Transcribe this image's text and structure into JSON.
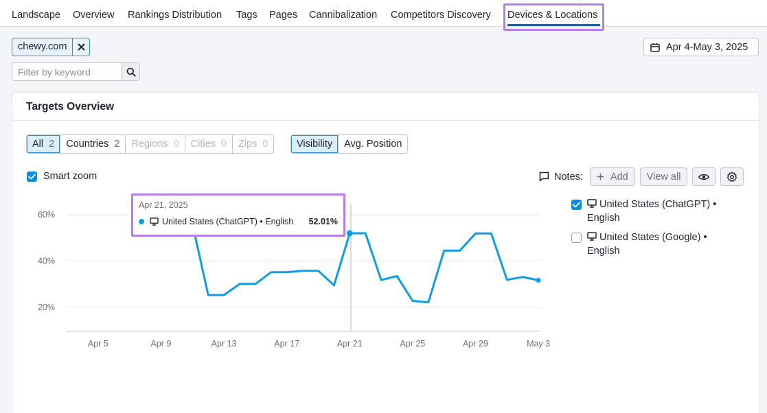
{
  "nav": {
    "tabs": [
      "Landscape",
      "Overview",
      "Rankings Distribution",
      "Tags",
      "Pages",
      "Cannibalization",
      "Competitors Discovery",
      "Devices & Locations"
    ],
    "active": "Devices & Locations"
  },
  "domain_chip": {
    "label": "chewy.com"
  },
  "filter": {
    "placeholder": "Filter by keyword"
  },
  "date_range": {
    "label": "Apr 4-May 3, 2025"
  },
  "card": {
    "title": "Targets Overview",
    "scope": [
      {
        "label": "All",
        "count": "2"
      },
      {
        "label": "Countries",
        "count": "2"
      },
      {
        "label": "Regions",
        "count": "0"
      },
      {
        "label": "Cities",
        "count": "0"
      },
      {
        "label": "Zips",
        "count": "0"
      }
    ],
    "metric": [
      "Visibility",
      "Avg. Position"
    ],
    "smart_zoom": "Smart zoom",
    "notes": {
      "label": "Notes:",
      "add": "Add",
      "view_all": "View all"
    },
    "legend": [
      {
        "line1": "United States (ChatGPT) •",
        "line2": "English",
        "checked": true
      },
      {
        "line1": "United States (Google) •",
        "line2": "English",
        "checked": false
      }
    ]
  },
  "tooltip": {
    "date": "Apr 21, 2025",
    "series": "United States (ChatGPT) • English",
    "value": "52.01%"
  },
  "colors": {
    "accent": "#0d9de8",
    "highlight": "#b57eef",
    "tab_underline": "#006dca"
  },
  "chart_data": {
    "type": "line",
    "x": [
      "Apr 4",
      "Apr 5",
      "Apr 6",
      "Apr 7",
      "Apr 8",
      "Apr 9",
      "Apr 10",
      "Apr 11",
      "Apr 12",
      "Apr 13",
      "Apr 14",
      "Apr 15",
      "Apr 16",
      "Apr 17",
      "Apr 18",
      "Apr 19",
      "Apr 20",
      "Apr 21",
      "Apr 22",
      "Apr 23",
      "Apr 24",
      "Apr 25",
      "Apr 26",
      "Apr 27",
      "Apr 28",
      "Apr 29",
      "Apr 30",
      "May 1",
      "May 2",
      "May 3"
    ],
    "series": [
      {
        "name": "United States (ChatGPT) • English",
        "values": [
          null,
          null,
          null,
          null,
          null,
          null,
          null,
          56,
          25.3,
          25.3,
          30.1,
          30.1,
          35.2,
          35.2,
          35.8,
          35.8,
          29.5,
          52.01,
          52.01,
          31.8,
          33.5,
          22.8,
          22.2,
          44.5,
          44.5,
          51.9,
          51.9,
          31.9,
          33.1,
          31.7
        ]
      }
    ],
    "x_ticks": [
      "Apr 5",
      "Apr 9",
      "Apr 13",
      "Apr 17",
      "Apr 21",
      "Apr 25",
      "Apr 29",
      "May 3"
    ],
    "y_ticks": [
      "20%",
      "40%",
      "60%"
    ],
    "ylim": [
      10,
      65
    ],
    "grid": true,
    "legend": "right"
  }
}
